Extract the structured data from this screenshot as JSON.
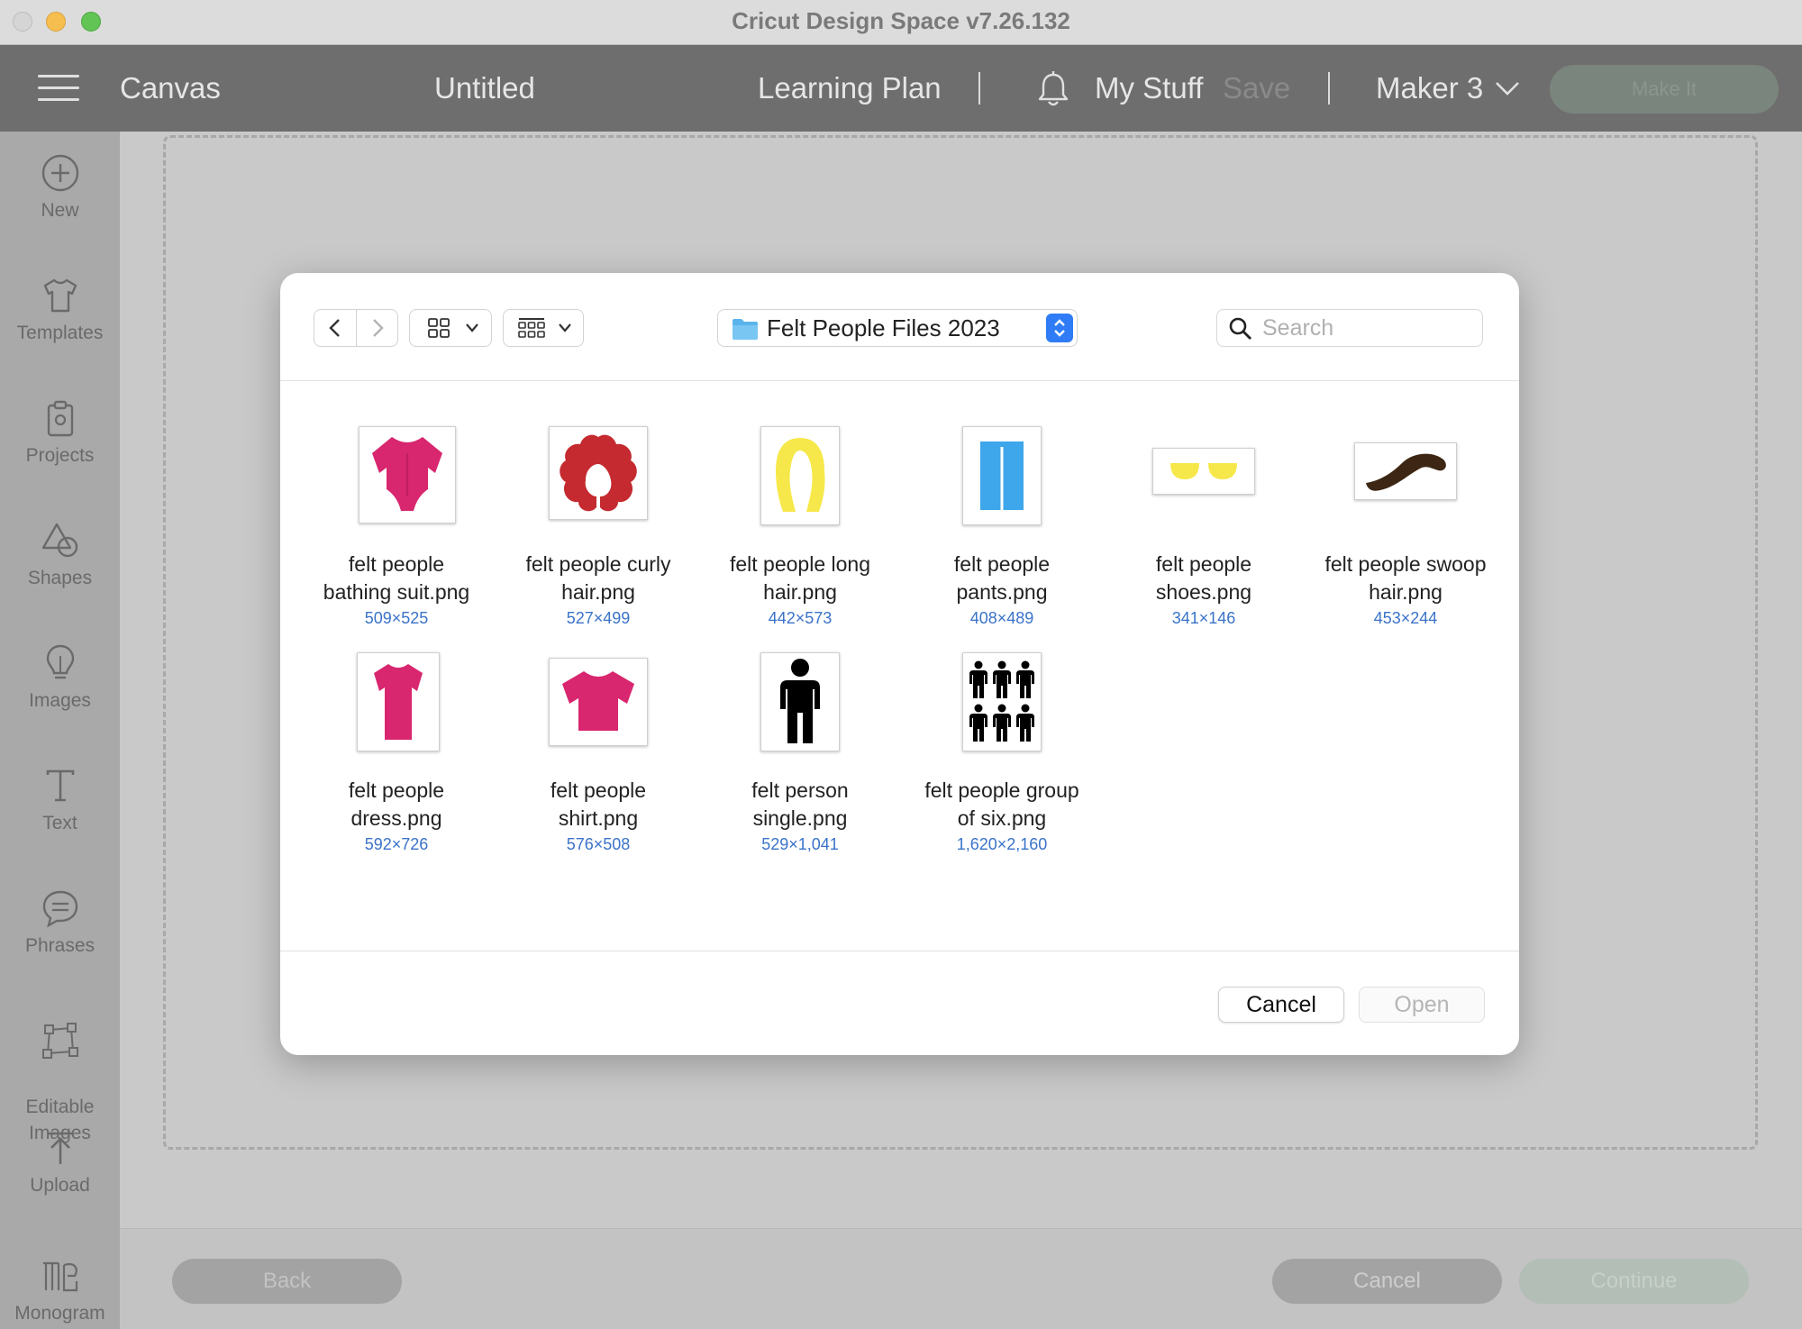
{
  "window": {
    "title": "Cricut Design Space  v7.26.132"
  },
  "header": {
    "canvas": "Canvas",
    "doc_title": "Untitled",
    "learning_plan": "Learning Plan",
    "my_stuff": "My Stuff",
    "save": "Save",
    "machine": "Maker 3",
    "make_it": "Make It"
  },
  "sidebar": {
    "items": [
      {
        "label": "New",
        "icon": "plus-circle-icon"
      },
      {
        "label": "Templates",
        "icon": "tshirt-icon"
      },
      {
        "label": "Projects",
        "icon": "clipboard-icon"
      },
      {
        "label": "Shapes",
        "icon": "shapes-icon"
      },
      {
        "label": "Images",
        "icon": "lightbulb-icon"
      },
      {
        "label": "Text",
        "icon": "text-icon"
      },
      {
        "label": "Phrases",
        "icon": "speech-bubble-icon"
      },
      {
        "label": "Editable\nImages",
        "icon": "vector-nodes-icon"
      },
      {
        "label": "Upload",
        "icon": "upload-icon"
      },
      {
        "label": "Monogram",
        "icon": "monogram-icon"
      }
    ]
  },
  "bottom_bar": {
    "back": "Back",
    "cancel": "Cancel",
    "continue": "Continue"
  },
  "dialog": {
    "folder": "Felt People Files 2023",
    "search_placeholder": "Search",
    "cancel": "Cancel",
    "open": "Open",
    "files": [
      {
        "name": "felt people\nbathing suit.png",
        "dims": "509×525",
        "color": "#d8266f"
      },
      {
        "name": "felt people curly\nhair.png",
        "dims": "527×499",
        "color": "#c42a2f"
      },
      {
        "name": "felt people long\nhair.png",
        "dims": "442×573",
        "color": "#f6e84a"
      },
      {
        "name": "felt people\npants.png",
        "dims": "408×489",
        "color": "#3ea6ea"
      },
      {
        "name": "felt people\nshoes.png",
        "dims": "341×146",
        "color": "#f6e84a"
      },
      {
        "name": "felt people swoop\nhair.png",
        "dims": "453×244",
        "color": "#3d2714"
      },
      {
        "name": "felt people\ndress.png",
        "dims": "592×726",
        "color": "#d8266f"
      },
      {
        "name": "felt people\nshirt.png",
        "dims": "576×508",
        "color": "#d8266f"
      },
      {
        "name": "felt person\nsingle.png",
        "dims": "529×1,041",
        "color": "#000000"
      },
      {
        "name": "felt people group\nof six.png",
        "dims": "1,620×2,160",
        "color": "#000000"
      }
    ]
  }
}
